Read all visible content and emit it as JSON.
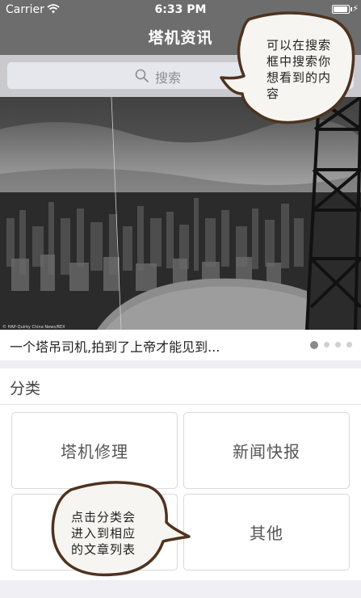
{
  "status_bar": {
    "carrier": "Carrier",
    "time": "6:33 PM",
    "battery_level": 0.95
  },
  "nav": {
    "title": "塔机资讯"
  },
  "search": {
    "placeholder": "搜索",
    "icon": "search-icon"
  },
  "banner": {
    "photo_credit": "© HAP-Quirky China News/REX",
    "caption": "一个塔吊司机,拍到了上帝才能见到...",
    "page_count": 4,
    "active_page": 1
  },
  "categories": {
    "title": "分类",
    "items": [
      {
        "label": "塔机修理"
      },
      {
        "label": "新闻快报"
      },
      {
        "label": ""
      },
      {
        "label": "其他"
      }
    ]
  },
  "annotations": {
    "search_tip": "可以在搜索\n框中搜索你\n想看到的内\n容",
    "category_tip": "点击分类会\n进入到相应\n的文章列表"
  },
  "colors": {
    "nav_background": "#6d6d6d",
    "search_background": "#c9c9ce",
    "page_background": "#efeff4",
    "callout_border": "#5a3a1e"
  }
}
